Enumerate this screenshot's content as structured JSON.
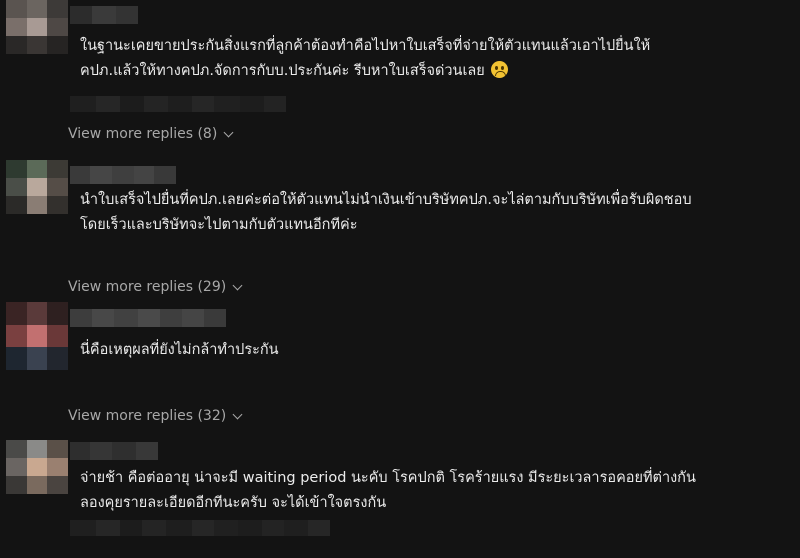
{
  "comments": [
    {
      "text_line1": "ในฐานะเคยขายประกันสิ่งแรกที่ลูกค้าต้องทำคือไปหาใบเสร็จที่จ่ายให้ตัวแทนแล้วเอาไปยื่นให้",
      "text_line2": "คปภ.แล้วให้ทางคปภ.จัดการกับบ.ประกันค่ะ รีบหาใบเสร็จด่วนเลย",
      "emoji": "frowning-face-icon",
      "view_replies": "View more replies (8)"
    },
    {
      "text_line1": "นำใบเสร็จไปยื่นที่คปภ.เลยค่ะต่อให้ตัวแทนไม่นำเงินเข้าบริษัทคปภ.จะไล่ตามกับบริษัทเพื่อรับผิดชอบ",
      "text_line2": "โดยเร็วและบริษัทจะไปตามกับตัวแทนอีกทีค่ะ",
      "view_replies": "View more replies (29)"
    },
    {
      "text_line1": "นี่คือเหตุผลที่ยังไม่กล้าทำประกัน",
      "view_replies": "View more replies (32)"
    },
    {
      "text_line1": "จ่ายช้า คือต่ออายุ น่าจะมี waiting period นะคับ โรคปกติ โรคร้ายแรง มีระยะเวลารอคอยที่ต่างกัน",
      "text_line2": "ลองคุยรายละเอียดอีกทีนะครับ จะได้เข้าใจตรงกัน"
    }
  ],
  "colors": {
    "background": "#131313",
    "text": "#ececec",
    "muted": "#a8a8a8",
    "emoji": "#f2c232"
  }
}
